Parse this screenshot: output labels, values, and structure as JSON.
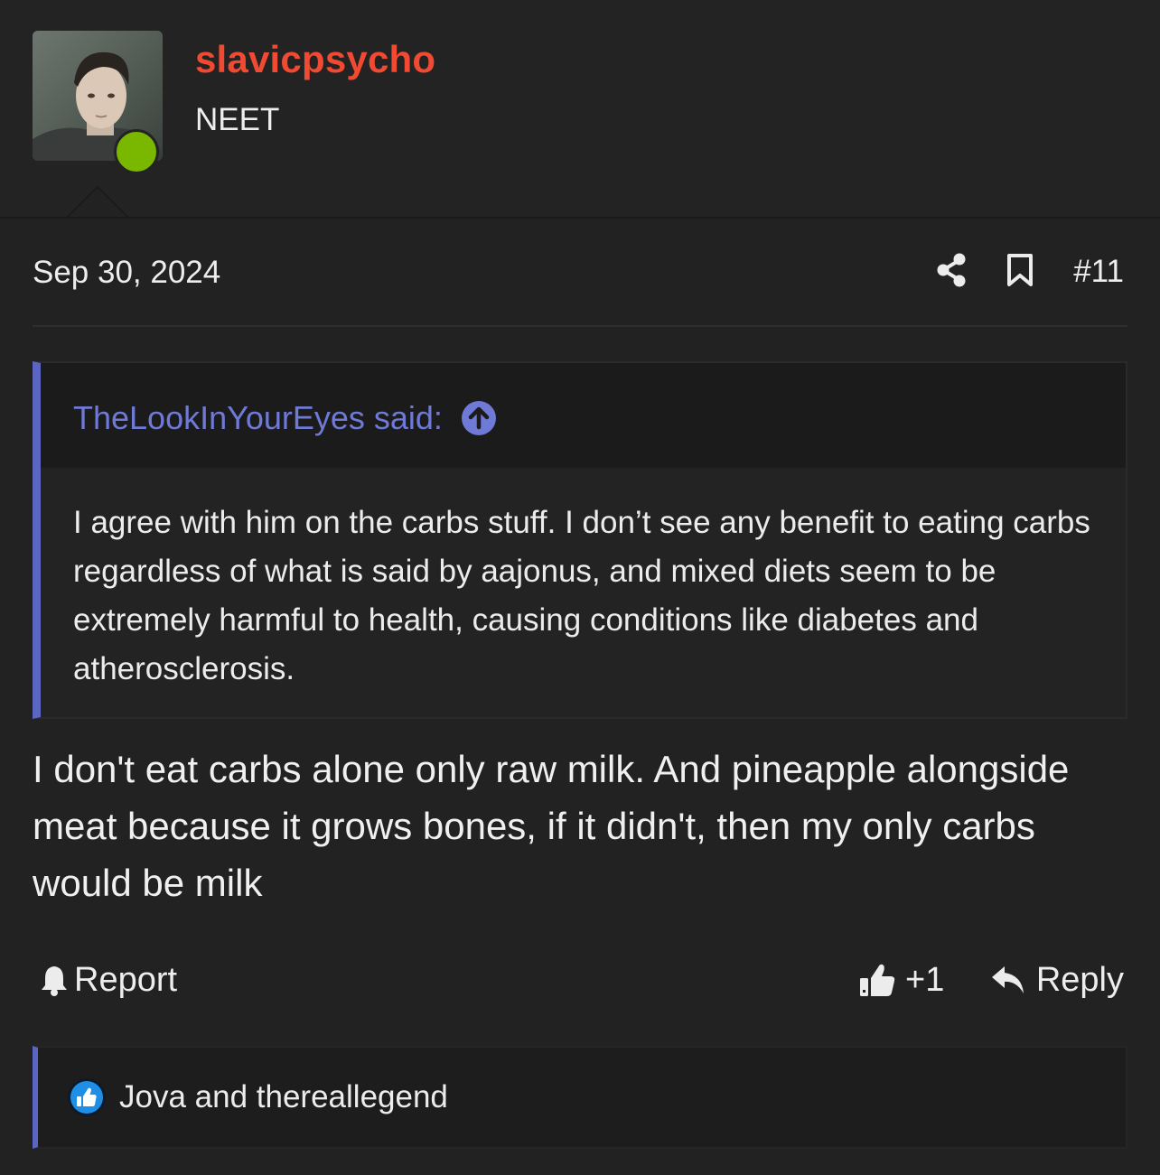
{
  "user": {
    "username": "slavicpsycho",
    "title": "NEET",
    "online": true
  },
  "post": {
    "date": "Sep 30, 2024",
    "number": "#11",
    "body": "I don't eat carbs alone only raw milk. And pineapple alongside meat because it grows bones, if it didn't, then my only carbs would be milk"
  },
  "quote": {
    "author_label": "TheLookInYourEyes said:",
    "text": "I agree with him on the carbs stuff. I don’t see any benefit to eating carbs regardless of what is said by aajonus, and mixed diets seem to be extremely harmful to health, causing conditions like diabetes and atherosclerosis."
  },
  "actions": {
    "report_label": "Report",
    "like_count": "+1",
    "reply_label": "Reply"
  },
  "reactions": {
    "names": "Jova and thereallegend"
  },
  "colors": {
    "username": "#f04a32",
    "accent": "#5b66c2",
    "quote_author": "#6f7ad6",
    "online": "#7ab800",
    "like_badge": "#1f8fe6"
  },
  "icons": {
    "share": "share-icon",
    "bookmark": "bookmark-icon",
    "quote_jump": "arrow-up-circle-icon",
    "report": "bell-icon",
    "like": "thumbs-up-icon",
    "reply": "reply-icon",
    "reaction": "like-reaction-icon"
  }
}
